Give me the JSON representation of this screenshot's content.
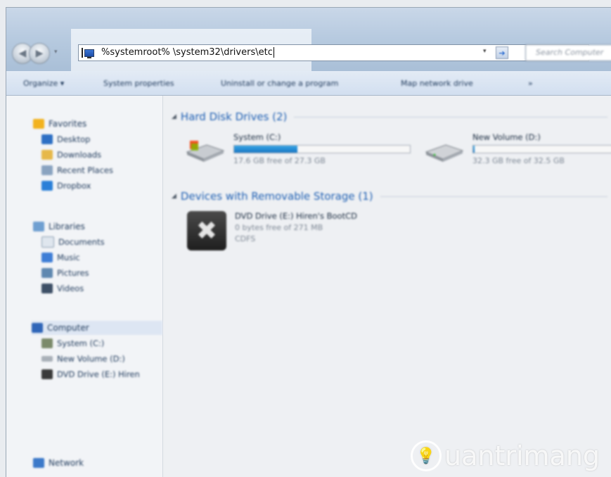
{
  "address_bar": {
    "path": "%systemroot% \\system32\\drivers\\etc",
    "dropdown_glyph": "▾",
    "go_glyph": "➔"
  },
  "search": {
    "placeholder": "Search Computer"
  },
  "toolbar": {
    "items": [
      "Organize ▾",
      "System properties",
      "Uninstall or change a program",
      "Map network drive",
      "»"
    ]
  },
  "sidebar": {
    "favorites": {
      "label": "Favorites",
      "items": [
        "Desktop",
        "Downloads",
        "Recent Places",
        "Dropbox"
      ]
    },
    "libraries": {
      "label": "Libraries",
      "items": [
        "Documents",
        "Music",
        "Pictures",
        "Videos"
      ]
    },
    "computer": {
      "label": "Computer",
      "items": [
        "System (C:)",
        "New Volume (D:)",
        "DVD Drive (E:) Hiren"
      ]
    },
    "network": {
      "label": "Network"
    }
  },
  "main": {
    "hard_disks": {
      "header": "Hard Disk Drives (2)",
      "drives": [
        {
          "name": "System (C:)",
          "free_text": "17.6 GB free of 27.3 GB",
          "used_fraction": 0.36
        },
        {
          "name": "New Volume (D:)",
          "free_text": "32.3 GB free of 32.5 GB",
          "used_fraction": 0.01
        }
      ]
    },
    "removable": {
      "header": "Devices with Removable Storage (1)",
      "devices": [
        {
          "name": "DVD Drive (E:) Hiren's BootCD",
          "free_text": "0 bytes free of 271 MB",
          "fs": "CDFS"
        }
      ]
    }
  },
  "watermark": {
    "text": "uantrimang"
  },
  "colors": {
    "accent": "#1e5fb3",
    "bar_fill": "#1877c4"
  }
}
